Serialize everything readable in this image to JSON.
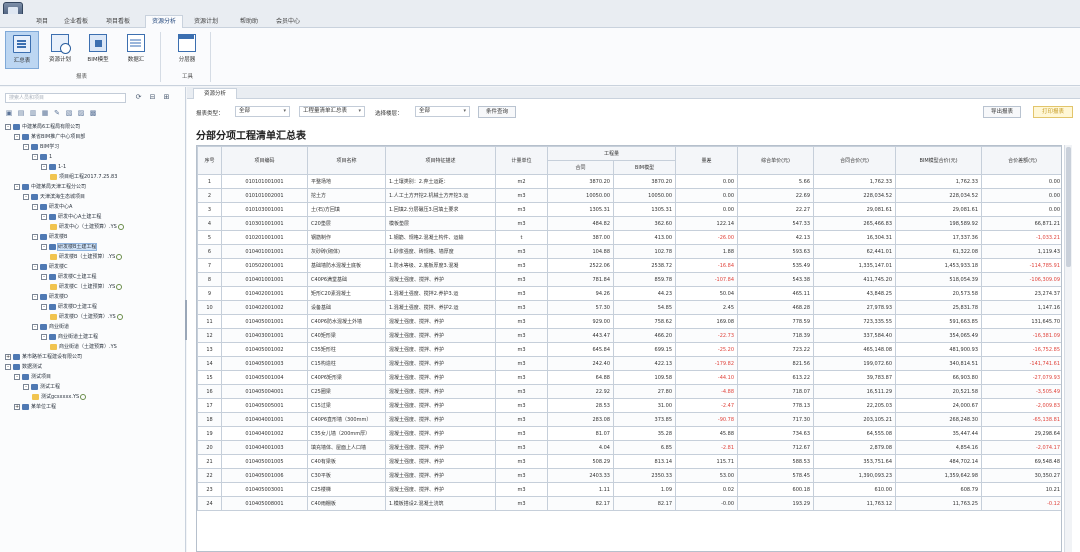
{
  "window": {
    "title": ""
  },
  "menu": [
    "项目",
    "企业看板",
    "项目看板",
    "资源分析",
    "资源计划",
    "帮助助",
    "会员中心"
  ],
  "ribbon": {
    "buttons": [
      {
        "label": "汇总表",
        "icon": "summary-doc-icon"
      },
      {
        "label": "资源计划",
        "icon": "resource-plan-icon"
      },
      {
        "label": "BIM模型",
        "icon": "bim-model-icon"
      },
      {
        "label": "数据汇",
        "icon": "data-summary-icon"
      },
      {
        "label": "分层器",
        "icon": "layer-tool-icon"
      }
    ],
    "groups": [
      "报表",
      "工具"
    ]
  },
  "left": {
    "search_placeholder": "搜索人员和项目",
    "tree": [
      {
        "label": "中建某局6工程局有限公司",
        "level": 0,
        "exp": "-"
      },
      {
        "label": "某省BIM推广中心项目部",
        "level": 1,
        "exp": "-"
      },
      {
        "label": "BIM学习",
        "level": 2,
        "exp": "-"
      },
      {
        "label": "1",
        "level": 3,
        "exp": "-"
      },
      {
        "label": "1-1",
        "level": 4,
        "exp": "-"
      },
      {
        "label": "项目组工程2017.7.25.83",
        "level": 5,
        "leaf": true
      },
      {
        "label": "中建某局天津工程分公司",
        "level": 1,
        "exp": "-"
      },
      {
        "label": "天津滨海生态城项目",
        "level": 2,
        "exp": "-"
      },
      {
        "label": "研发中心A",
        "level": 3,
        "exp": "-"
      },
      {
        "label": "研发中心A土建工程",
        "level": 4,
        "exp": "-"
      },
      {
        "label": "研发中心（土建预算）.YS",
        "level": 5,
        "leaf": true,
        "ok": true
      },
      {
        "label": "研发楼B",
        "level": 3,
        "exp": "-"
      },
      {
        "label": "研发楼B土建工程",
        "level": 4,
        "exp": "-",
        "sel": true
      },
      {
        "label": "研发楼B（土建预算）.YS",
        "level": 5,
        "leaf": true,
        "ok": true
      },
      {
        "label": "研发楼C",
        "level": 3,
        "exp": "-"
      },
      {
        "label": "研发楼C土建工程",
        "level": 4,
        "exp": "-"
      },
      {
        "label": "研发楼C（土建预算）.YS",
        "level": 5,
        "leaf": true,
        "ok": true
      },
      {
        "label": "研发楼D",
        "level": 3,
        "exp": "-"
      },
      {
        "label": "研发楼D土建工程",
        "level": 4,
        "exp": "-"
      },
      {
        "label": "研发楼D（土建预算）.YS",
        "level": 5,
        "leaf": true,
        "ok": true
      },
      {
        "label": "商业街道",
        "level": 3,
        "exp": "-"
      },
      {
        "label": "商业街道土建工程",
        "level": 4,
        "exp": "-"
      },
      {
        "label": "商业街道（土建预算）.YS",
        "level": 5,
        "leaf": true
      },
      {
        "label": "某市路桥工程建设有限公司",
        "level": 0,
        "exp": "+"
      },
      {
        "label": "数据测试",
        "level": 0,
        "exp": "-"
      },
      {
        "label": "测试项目",
        "level": 1,
        "exp": "-"
      },
      {
        "label": "测试工程",
        "level": 2,
        "exp": "-"
      },
      {
        "label": "测试gcsxxxx.YS",
        "level": 3,
        "leaf": true,
        "ok": true
      },
      {
        "label": "某单位工程",
        "level": 1,
        "exp": "+"
      }
    ]
  },
  "tab": "资源分析",
  "filters": {
    "type_label": "报表类型：",
    "type_value": "全部",
    "view_value": "工程量清单汇总表",
    "period_label": "选择楼层：",
    "period_value": "全部",
    "query_button": "条件查询",
    "export_button": "导出报表",
    "print_button": "打印报表"
  },
  "report_title": "分部分项工程清单汇总表",
  "table": {
    "headers": [
      "序号",
      "项目编码",
      "项目名称",
      "项目特征描述",
      "计量单位",
      "工程量",
      "合同",
      "BIM模型",
      "量差",
      "综合单价(元)",
      "合同合价(元)",
      "BIM模型合价(元)",
      "合价差额(元)"
    ],
    "rows": [
      [
        "1",
        "010101001001",
        "平整场地",
        "1.土壤类别：2.弃土运距：",
        "m2",
        "3870.20",
        "3870.20",
        "0.00",
        "5.66",
        "1,762.33",
        "1,762.33",
        "0.00"
      ],
      [
        "2",
        "010101002001",
        "挖土方",
        "1.人工土方开挖2.机械土方开挖3.运",
        "m3",
        "10050.00",
        "10050.00",
        "0.00",
        "22.69",
        "228,034.52",
        "228,034.52",
        "0.00"
      ],
      [
        "3",
        "010103001001",
        "土(石)方回填",
        "1.回填2.分层碾压3.回填土要求",
        "m3",
        "1305.31",
        "1305.31",
        "0.00",
        "22.27",
        "29,081.61",
        "29,081.61",
        "0.00"
      ],
      [
        "4",
        "010301001001",
        "C20垫层",
        "模板垫层",
        "m3",
        "484.82",
        "362.60",
        "122.14",
        "547.33",
        "265,466.83",
        "198,589.92",
        "66,871.21"
      ],
      [
        "5",
        "010201001001",
        "钢筋制作",
        "1.钢筋、规格2.混凝土构件、运输",
        "t",
        "387.00",
        "413.00",
        "-26.00",
        "42.13",
        "16,304.31",
        "17,337.36",
        "-1,033.21"
      ],
      [
        "6",
        "010401001001",
        "灰砂砖(砌体)",
        "1.砂浆强度、砖规格、墙厚度",
        "m3",
        "104.88",
        "102.78",
        "1.88",
        "593.63",
        "62,441.01",
        "61,322.08",
        "1,119.43"
      ],
      [
        "7",
        "010502001001",
        "基础墙防水混凝土底板",
        "1.防水等级、2.底板厚度3.混凝",
        "m3",
        "2522.06",
        "2538.72",
        "-16.84",
        "535.49",
        "1,335,147.01",
        "1,453,933.18",
        "-114,785.91"
      ],
      [
        "8",
        "010401001001",
        "C40P6满堂基础",
        "混凝土强度、搅拌、养护",
        "m3",
        "781.84",
        "859.78",
        "-107.84",
        "543.38",
        "411,745.20",
        "518,054.39",
        "-106,309.09"
      ],
      [
        "9",
        "010402001001",
        "矩形C20素混凝土",
        "1.混凝土强度、搅拌2.养护3.运",
        "m3",
        "94.26",
        "44.23",
        "50.04",
        "465.11",
        "43,848.25",
        "20,573.58",
        "23,274.37"
      ],
      [
        "10",
        "010402001002",
        "设备基础",
        "1.混凝土强度、搅拌、养护2.运",
        "m3",
        "57.30",
        "54.85",
        "2.45",
        "468.28",
        "27,978.93",
        "25,831.78",
        "1,147.16"
      ],
      [
        "11",
        "010405001001",
        "C40P6防水混凝土外墙",
        "混凝土强度、搅拌、养护",
        "m3",
        "929.00",
        "758.62",
        "169.08",
        "778.59",
        "723,335.55",
        "591,663.85",
        "131,645.70"
      ],
      [
        "12",
        "010403001001",
        "C40矩形梁",
        "混凝土强度、搅拌、养护",
        "m3",
        "443.47",
        "466.20",
        "-22.73",
        "718.39",
        "337,584.40",
        "354,065.49",
        "-16,381.09"
      ],
      [
        "13",
        "010405001002",
        "C35矩形柱",
        "混凝土强度、搅拌、养护",
        "m3",
        "645.84",
        "699.15",
        "-25.20",
        "723.22",
        "465,148.08",
        "481,900.93",
        "-16,752.85"
      ],
      [
        "14",
        "010405001003",
        "C15构造柱",
        "混凝土强度、搅拌、养护",
        "m3",
        "242.40",
        "422.13",
        "-179.82",
        "821.56",
        "199,072.60",
        "340,814.51",
        "-141,741.61"
      ],
      [
        "15",
        "010405001004",
        "C40P6矩形梁",
        "混凝土强度、搅拌、养护",
        "m3",
        "64.88",
        "109.58",
        "-44.10",
        "613.22",
        "39,783.87",
        "66,903.80",
        "-27,079.93"
      ],
      [
        "16",
        "010405004001",
        "C25圈梁",
        "混凝土强度、搅拌、养护",
        "m3",
        "22.92",
        "27.80",
        "-4.88",
        "718.07",
        "16,511.29",
        "20,521.58",
        "-3,505.49"
      ],
      [
        "17",
        "010405005001",
        "C15过梁",
        "混凝土强度、搅拌、养护",
        "m3",
        "28.53",
        "31.00",
        "-2.47",
        "778.13",
        "22,205.03",
        "24,000.67",
        "-2,009.83"
      ],
      [
        "18",
        "010404001001",
        "C40P6直形墙（300mm）",
        "混凝土强度、搅拌、养护",
        "m3",
        "283.08",
        "373.85",
        "-90.78",
        "717.30",
        "203,105.21",
        "268,248.30",
        "-65,138.81"
      ],
      [
        "19",
        "010404001002",
        "C35女儿墙（200mm厚）",
        "混凝土强度、搅拌、养护",
        "m3",
        "81.07",
        "35.28",
        "45.88",
        "734.63",
        "64,555.08",
        "35,447.44",
        "29,298.64"
      ],
      [
        "20",
        "010404001003",
        "填充墙体、屋面上人口墙",
        "混凝土强度、搅拌、养护",
        "m3",
        "4.04",
        "6.85",
        "-2.81",
        "712.67",
        "2,879.08",
        "4,854.16",
        "-2,074.17"
      ],
      [
        "21",
        "010405001005",
        "C40有梁板",
        "混凝土强度、搅拌、养护",
        "m3",
        "508.29",
        "813.14",
        "115.71",
        "588.53",
        "353,751.64",
        "484,702.14",
        "69,548.48"
      ],
      [
        "22",
        "010405001006",
        "C30平板",
        "混凝土强度、搅拌、养护",
        "m3",
        "2403.33",
        "2350.33",
        "53.00",
        "578.45",
        "1,390,093.23",
        "1,359,642.98",
        "30,350.27"
      ],
      [
        "23",
        "010405003001",
        "C25楼梯",
        "混凝土强度、搅拌、养护",
        "m3",
        "1.11",
        "1.09",
        "0.02",
        "600.18",
        "610.00",
        "608.79",
        "10.21"
      ],
      [
        "24",
        "010405008001",
        "C40雨棚板",
        "1.模板搭设2.混凝土浇筑",
        "m3",
        "82.17",
        "82.17",
        "-0.00",
        "193.29",
        "11,763.12",
        "11,763.25",
        "-0.12"
      ]
    ]
  },
  "colors": {
    "accent": "#3c6fb0",
    "negative": "#e0443c"
  }
}
